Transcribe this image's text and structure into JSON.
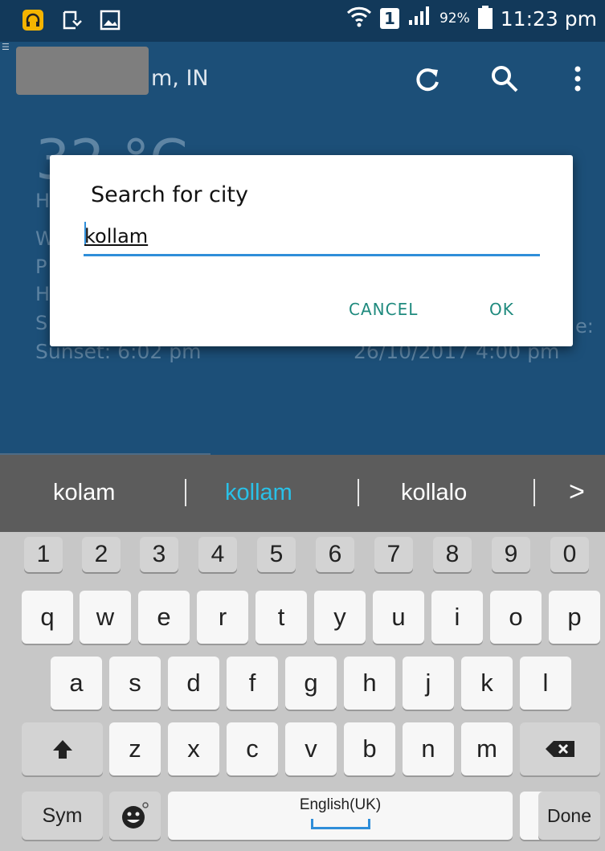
{
  "status_bar": {
    "signal_sim": "1",
    "battery_percent": "92%",
    "time": "11:23 pm"
  },
  "app_bar": {
    "title": "m, IN"
  },
  "background": {
    "temperature": "32 °C",
    "sunset": "Sunset: 6:02 pm",
    "updated": "26/10/2017 4:00 pm",
    "edge_letters": [
      "H",
      "W",
      "P",
      "H",
      "S"
    ],
    "edge_right": "e:"
  },
  "dialog": {
    "title": "Search for city",
    "input_value": "kollam",
    "cancel_label": "CANCEL",
    "ok_label": "OK"
  },
  "suggestions": {
    "items": [
      "kolam",
      "kollam",
      "kollalo"
    ],
    "active_index": 1,
    "arrow": ">"
  },
  "keyboard": {
    "number_row": [
      "1",
      "2",
      "3",
      "4",
      "5",
      "6",
      "7",
      "8",
      "9",
      "0"
    ],
    "row1": [
      "q",
      "w",
      "e",
      "r",
      "t",
      "y",
      "u",
      "i",
      "o",
      "p"
    ],
    "row2": [
      "a",
      "s",
      "d",
      "f",
      "g",
      "h",
      "j",
      "k",
      "l"
    ],
    "row3": [
      "z",
      "x",
      "c",
      "v",
      "b",
      "n",
      "m"
    ],
    "sym_label": "Sym",
    "space_label": "English(UK)",
    "period_label": ".",
    "period_hint": "..?",
    "done_label": "Done"
  }
}
